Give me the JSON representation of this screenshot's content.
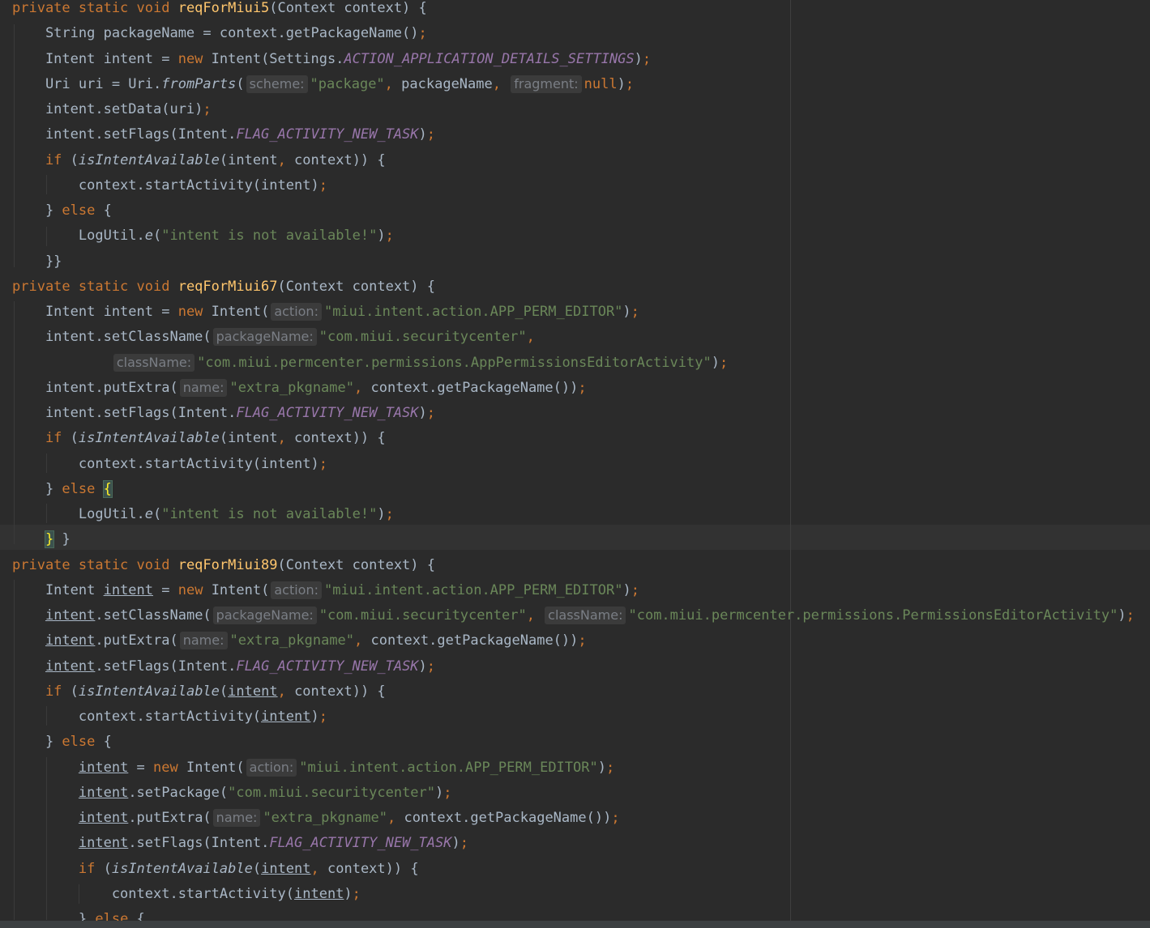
{
  "editor": {
    "lines": [
      [
        [
          "kw",
          "private static void "
        ],
        [
          "fn",
          "reqForMiui5"
        ],
        [
          "p",
          "(Context context) {"
        ]
      ],
      [
        [
          "p",
          "    String packageName = context.getPackageName()"
        ],
        [
          "kw",
          ";"
        ]
      ],
      [
        [
          "p",
          "    Intent intent = "
        ],
        [
          "kw",
          "new "
        ],
        [
          "p",
          "Intent(Settings."
        ],
        [
          "cst",
          "ACTION_APPLICATION_DETAILS_SETTINGS"
        ],
        [
          "p",
          ")"
        ],
        [
          "kw",
          ";"
        ]
      ],
      [
        [
          "p",
          "    Uri uri = Uri."
        ],
        [
          "st",
          "fromParts"
        ],
        [
          "p",
          "("
        ],
        [
          "hint",
          "scheme:"
        ],
        [
          "str",
          "\"package\""
        ],
        [
          "kw",
          ", "
        ],
        [
          "p",
          "packageName"
        ],
        [
          "kw",
          ", "
        ],
        [
          "hint",
          "fragment:"
        ],
        [
          "kw",
          "null"
        ],
        [
          "p",
          ")"
        ],
        [
          "kw",
          ";"
        ]
      ],
      [
        [
          "p",
          "    intent.setData(uri)"
        ],
        [
          "kw",
          ";"
        ]
      ],
      [
        [
          "p",
          "    intent.setFlags(Intent."
        ],
        [
          "cst",
          "FLAG_ACTIVITY_NEW_TASK"
        ],
        [
          "p",
          ")"
        ],
        [
          "kw",
          ";"
        ]
      ],
      [
        [
          "kw",
          "    if "
        ],
        [
          "p",
          "("
        ],
        [
          "st",
          "isIntentAvailable"
        ],
        [
          "p",
          "(intent"
        ],
        [
          "kw",
          ", "
        ],
        [
          "p",
          "context)) {"
        ]
      ],
      [
        [
          "p",
          "        context.startActivity(intent)"
        ],
        [
          "kw",
          ";"
        ]
      ],
      [
        [
          "p",
          "    } "
        ],
        [
          "kw",
          "else "
        ],
        [
          "p",
          "{"
        ]
      ],
      [
        [
          "p",
          "        LogUtil."
        ],
        [
          "st",
          "e"
        ],
        [
          "p",
          "("
        ],
        [
          "str",
          "\"intent is not available!\""
        ],
        [
          "p",
          ")"
        ],
        [
          "kw",
          ";"
        ]
      ],
      [
        [
          "p",
          "    }}"
        ]
      ],
      [
        [
          "kw",
          "private static void "
        ],
        [
          "fn",
          "reqForMiui67"
        ],
        [
          "p",
          "(Context context) {"
        ]
      ],
      [
        [
          "p",
          "    Intent intent = "
        ],
        [
          "kw",
          "new "
        ],
        [
          "p",
          "Intent("
        ],
        [
          "hint",
          "action:"
        ],
        [
          "str",
          "\"miui.intent.action.APP_PERM_EDITOR\""
        ],
        [
          "p",
          ")"
        ],
        [
          "kw",
          ";"
        ]
      ],
      [
        [
          "p",
          "    intent.setClassName("
        ],
        [
          "hint",
          "packageName:"
        ],
        [
          "str",
          "\"com.miui.securitycenter\""
        ],
        [
          "kw",
          ","
        ]
      ],
      [
        [
          "p",
          "            "
        ],
        [
          "hint",
          "className:"
        ],
        [
          "str",
          "\"com.miui.permcenter.permissions.AppPermissionsEditorActivity\""
        ],
        [
          "p",
          ")"
        ],
        [
          "kw",
          ";"
        ]
      ],
      [
        [
          "p",
          "    intent.putExtra("
        ],
        [
          "hint",
          "name:"
        ],
        [
          "str",
          "\"extra_pkgname\""
        ],
        [
          "kw",
          ", "
        ],
        [
          "p",
          "context.getPackageName())"
        ],
        [
          "kw",
          ";"
        ]
      ],
      [
        [
          "p",
          "    intent.setFlags(Intent."
        ],
        [
          "cst",
          "FLAG_ACTIVITY_NEW_TASK"
        ],
        [
          "p",
          ")"
        ],
        [
          "kw",
          ";"
        ]
      ],
      [
        [
          "kw",
          "    if "
        ],
        [
          "p",
          "("
        ],
        [
          "st",
          "isIntentAvailable"
        ],
        [
          "p",
          "(intent"
        ],
        [
          "kw",
          ", "
        ],
        [
          "p",
          "context)) {"
        ]
      ],
      [
        [
          "p",
          "        context.startActivity(intent)"
        ],
        [
          "kw",
          ";"
        ]
      ],
      [
        [
          "p",
          "    } "
        ],
        [
          "kw",
          "else "
        ],
        [
          "hl",
          "{"
        ]
      ],
      [
        [
          "p",
          "        LogUtil."
        ],
        [
          "st",
          "e"
        ],
        [
          "p",
          "("
        ],
        [
          "str",
          "\"intent is not available!\""
        ],
        [
          "p",
          ")"
        ],
        [
          "kw",
          ";"
        ]
      ],
      [
        [
          "p",
          "    "
        ],
        [
          "hl",
          "}"
        ],
        [
          "p",
          " }"
        ]
      ],
      [
        [
          "kw",
          "private static void "
        ],
        [
          "fn",
          "reqForMiui89"
        ],
        [
          "p",
          "(Context context) {"
        ]
      ],
      [
        [
          "p",
          "    Intent "
        ],
        [
          "ul",
          "intent"
        ],
        [
          "p",
          " = "
        ],
        [
          "kw",
          "new "
        ],
        [
          "p",
          "Intent("
        ],
        [
          "hint",
          "action:"
        ],
        [
          "str",
          "\"miui.intent.action.APP_PERM_EDITOR\""
        ],
        [
          "p",
          ")"
        ],
        [
          "kw",
          ";"
        ]
      ],
      [
        [
          "p",
          "    "
        ],
        [
          "ul",
          "intent"
        ],
        [
          "p",
          ".setClassName("
        ],
        [
          "hint",
          "packageName:"
        ],
        [
          "str",
          "\"com.miui.securitycenter\""
        ],
        [
          "kw",
          ", "
        ],
        [
          "hint",
          "className:"
        ],
        [
          "str",
          "\"com.miui.permcenter.permissions.PermissionsEditorActivity\""
        ],
        [
          "p",
          ")"
        ],
        [
          "kw",
          ";"
        ]
      ],
      [
        [
          "p",
          "    "
        ],
        [
          "ul",
          "intent"
        ],
        [
          "p",
          ".putExtra("
        ],
        [
          "hint",
          "name:"
        ],
        [
          "str",
          "\"extra_pkgname\""
        ],
        [
          "kw",
          ", "
        ],
        [
          "p",
          "context.getPackageName())"
        ],
        [
          "kw",
          ";"
        ]
      ],
      [
        [
          "p",
          "    "
        ],
        [
          "ul",
          "intent"
        ],
        [
          "p",
          ".setFlags(Intent."
        ],
        [
          "cst",
          "FLAG_ACTIVITY_NEW_TASK"
        ],
        [
          "p",
          ")"
        ],
        [
          "kw",
          ";"
        ]
      ],
      [
        [
          "kw",
          "    if "
        ],
        [
          "p",
          "("
        ],
        [
          "st",
          "isIntentAvailable"
        ],
        [
          "p",
          "("
        ],
        [
          "ul",
          "intent"
        ],
        [
          "kw",
          ", "
        ],
        [
          "p",
          "context)) {"
        ]
      ],
      [
        [
          "p",
          "        context.startActivity("
        ],
        [
          "ul",
          "intent"
        ],
        [
          "p",
          ")"
        ],
        [
          "kw",
          ";"
        ]
      ],
      [
        [
          "p",
          "    } "
        ],
        [
          "kw",
          "else "
        ],
        [
          "p",
          "{"
        ]
      ],
      [
        [
          "p",
          "        "
        ],
        [
          "ul",
          "intent"
        ],
        [
          "p",
          " = "
        ],
        [
          "kw",
          "new "
        ],
        [
          "p",
          "Intent("
        ],
        [
          "hint",
          "action:"
        ],
        [
          "str",
          "\"miui.intent.action.APP_PERM_EDITOR\""
        ],
        [
          "p",
          ")"
        ],
        [
          "kw",
          ";"
        ]
      ],
      [
        [
          "p",
          "        "
        ],
        [
          "ul",
          "intent"
        ],
        [
          "p",
          ".setPackage("
        ],
        [
          "str",
          "\"com.miui.securitycenter\""
        ],
        [
          "p",
          ")"
        ],
        [
          "kw",
          ";"
        ]
      ],
      [
        [
          "p",
          "        "
        ],
        [
          "ul",
          "intent"
        ],
        [
          "p",
          ".putExtra("
        ],
        [
          "hint",
          "name:"
        ],
        [
          "str",
          "\"extra_pkgname\""
        ],
        [
          "kw",
          ", "
        ],
        [
          "p",
          "context.getPackageName())"
        ],
        [
          "kw",
          ";"
        ]
      ],
      [
        [
          "p",
          "        "
        ],
        [
          "ul",
          "intent"
        ],
        [
          "p",
          ".setFlags(Intent."
        ],
        [
          "cst",
          "FLAG_ACTIVITY_NEW_TASK"
        ],
        [
          "p",
          ")"
        ],
        [
          "kw",
          ";"
        ]
      ],
      [
        [
          "kw",
          "        if "
        ],
        [
          "p",
          "("
        ],
        [
          "st",
          "isIntentAvailable"
        ],
        [
          "p",
          "("
        ],
        [
          "ul",
          "intent"
        ],
        [
          "kw",
          ", "
        ],
        [
          "p",
          "context)) {"
        ]
      ],
      [
        [
          "p",
          "            context.startActivity("
        ],
        [
          "ul",
          "intent"
        ],
        [
          "p",
          ")"
        ],
        [
          "kw",
          ";"
        ]
      ],
      [
        [
          "p",
          "        } "
        ],
        [
          "kw",
          "else "
        ],
        [
          "p",
          "{"
        ]
      ]
    ]
  }
}
